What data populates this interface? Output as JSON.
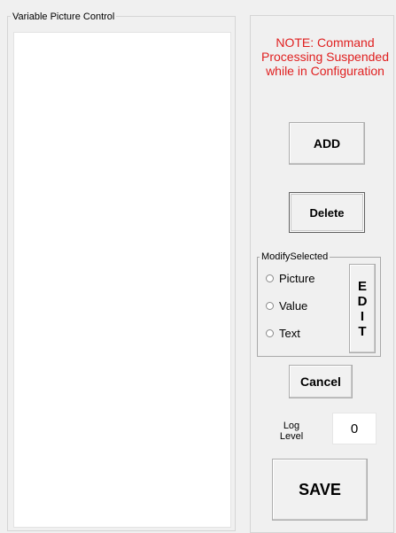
{
  "left_panel": {
    "title": "Variable Picture Control"
  },
  "right_panel": {
    "note": "NOTE: Command Processing Suspended while in Configuration",
    "add_label": "ADD",
    "delete_label": "Delete",
    "modify_group": {
      "title": "ModifySelected",
      "options": [
        {
          "label": "Picture",
          "selected": false
        },
        {
          "label": "Value",
          "selected": false
        },
        {
          "label": "Text",
          "selected": false
        }
      ],
      "edit_letters": [
        "E",
        "D",
        "I",
        "T"
      ]
    },
    "cancel_label": "Cancel",
    "log": {
      "label_line1": "Log",
      "label_line2": "Level",
      "value": "0"
    },
    "save_label": "SAVE"
  }
}
